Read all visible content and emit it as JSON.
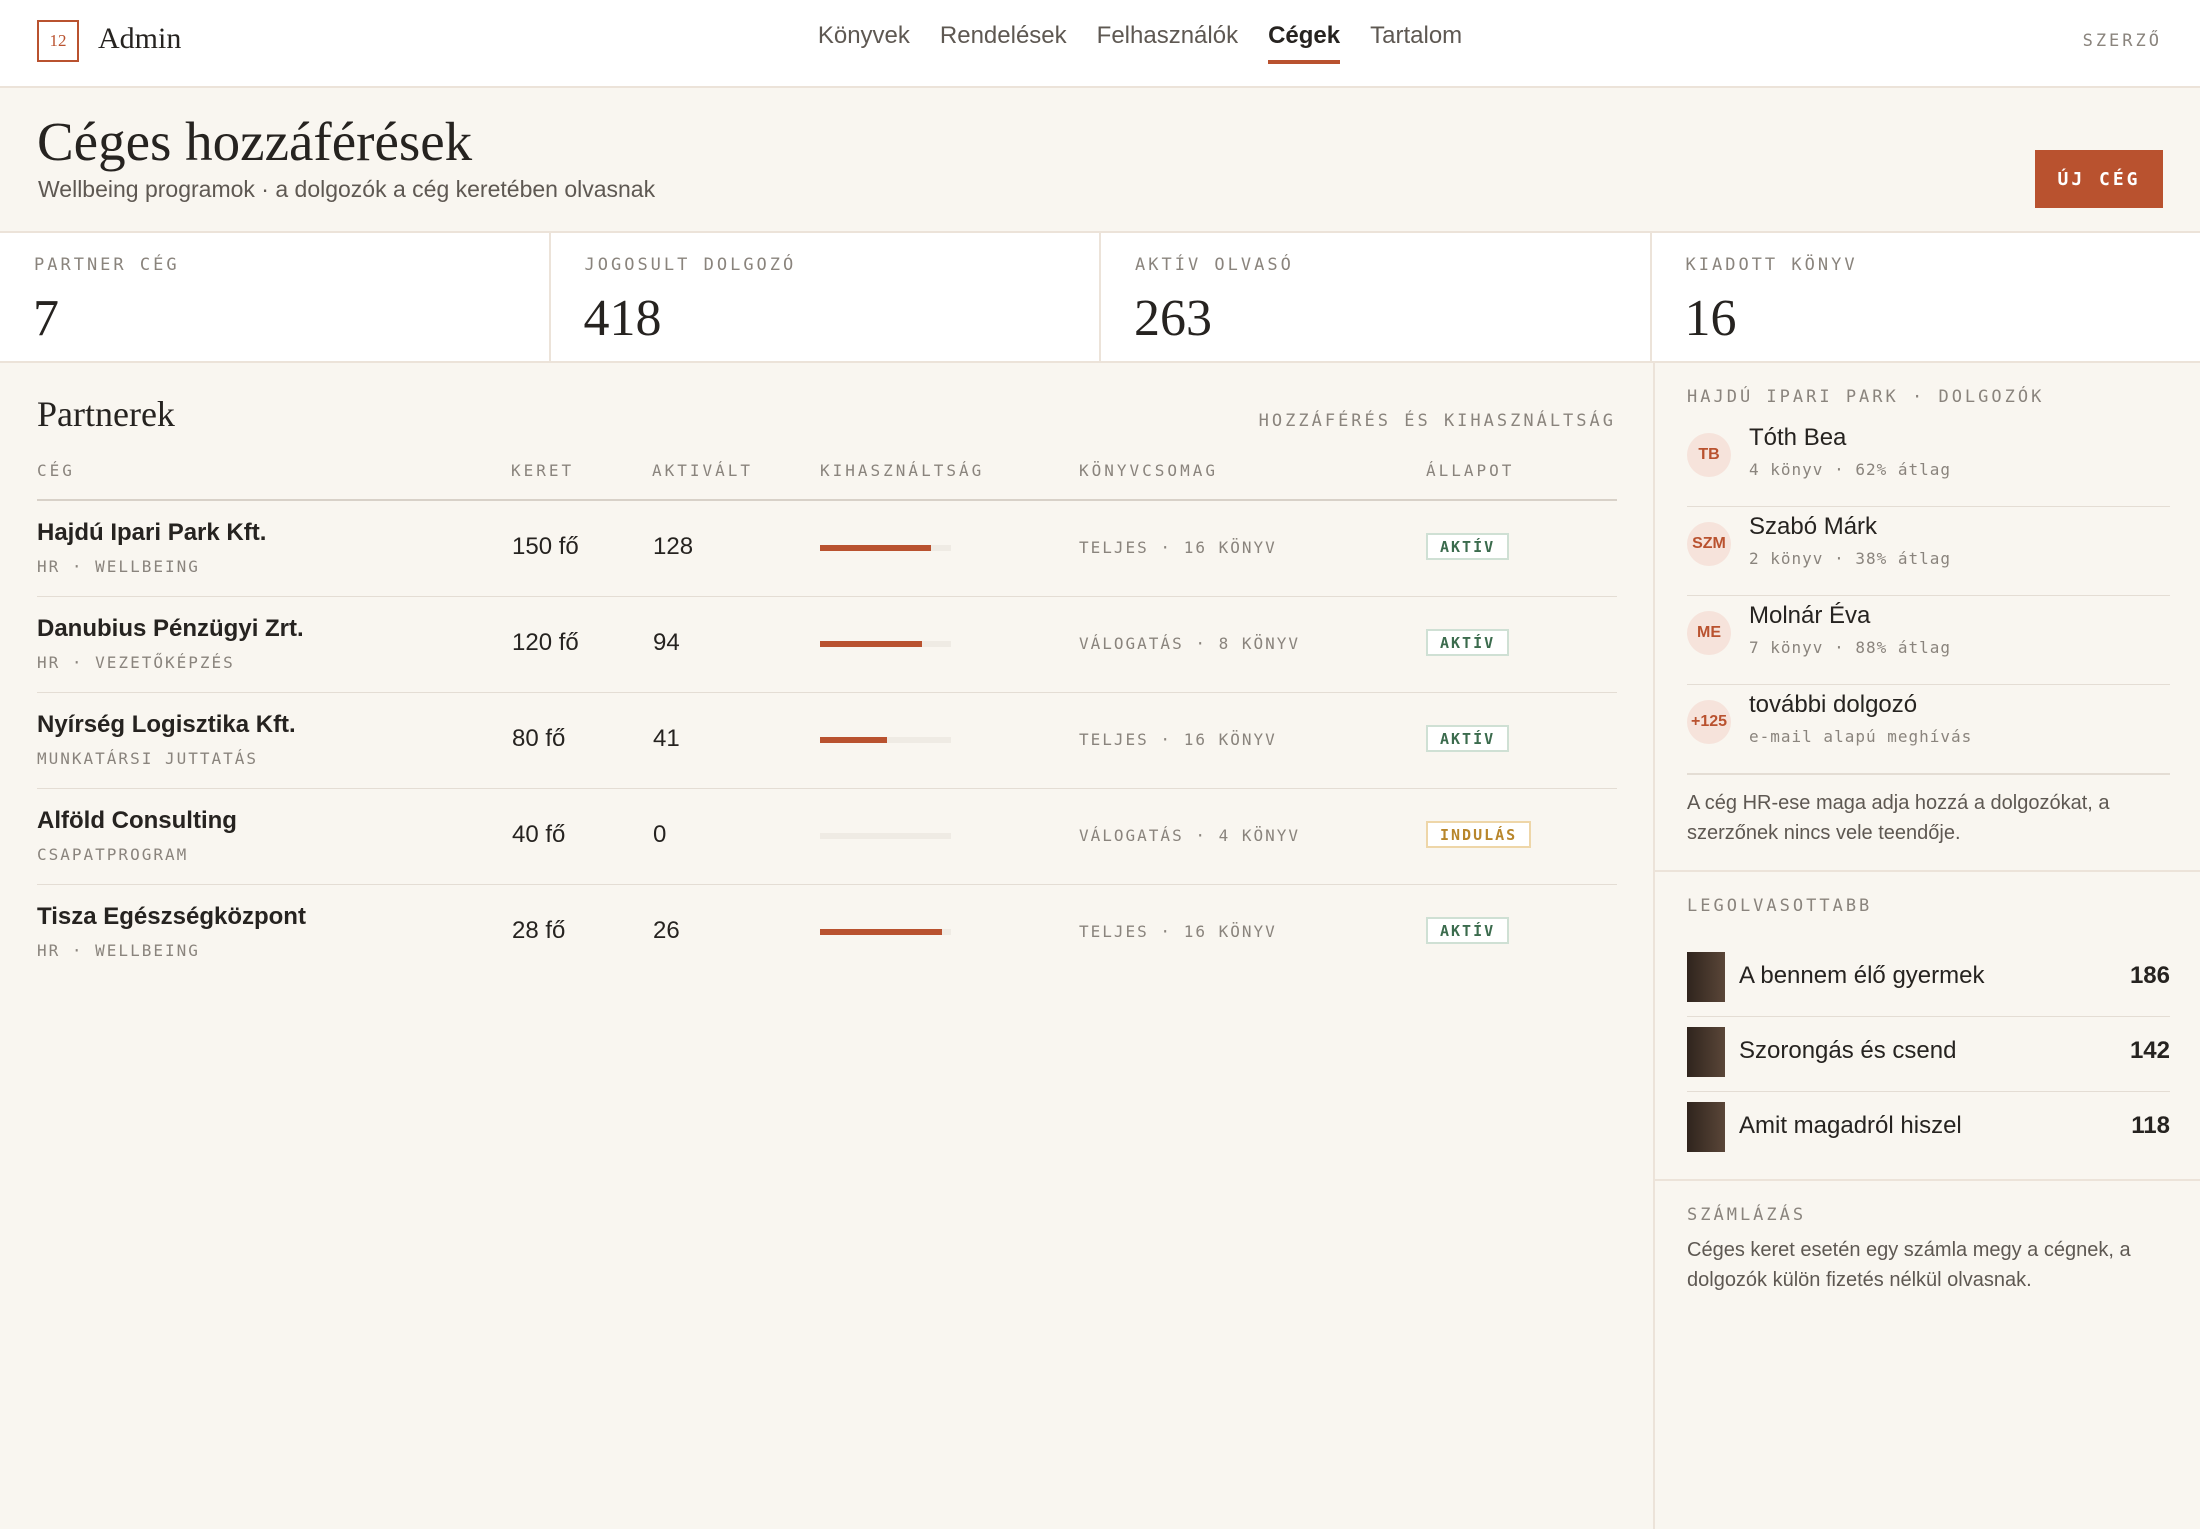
{
  "app": {
    "logo_text": "12",
    "brand": "Admin",
    "role": "SZERZŐ",
    "nav": [
      "Könyvek",
      "Rendelések",
      "Felhasználók",
      "Cégek",
      "Tartalom"
    ],
    "nav_active": "Cégek"
  },
  "header": {
    "title": "Céges hozzáférések",
    "subtitle": "Wellbeing programok · a dolgozók a cég keretében olvasnak",
    "new_button": "ÚJ CÉG"
  },
  "stats": [
    {
      "label": "PARTNER CÉG",
      "value": "7"
    },
    {
      "label": "JOGOSULT DOLGOZÓ",
      "value": "418"
    },
    {
      "label": "AKTÍV OLVASÓ",
      "value": "263"
    },
    {
      "label": "KIADOTT KÖNYV",
      "value": "16"
    }
  ],
  "partners": {
    "title": "Partnerek",
    "hint": "HOZZÁFÉRÉS ÉS KIHASZNÁLTSÁG",
    "columns": [
      "CÉG",
      "KERET",
      "AKTIVÁLT",
      "KIHASZNÁLTSÁG",
      "KÖNYVCSOMAG",
      "ÁLLAPOT"
    ],
    "rows": [
      {
        "name": "Hajdú Ipari Park Kft.",
        "sub": "HR · WELLBEING",
        "quota": "150 fő",
        "activated": "128",
        "usage": 0.85,
        "package": "TELJES · 16 KÖNYV",
        "status": "AKTÍV",
        "status_kind": "ok"
      },
      {
        "name": "Danubius Pénzügyi Zrt.",
        "sub": "HR · VEZETŐKÉPZÉS",
        "quota": "120 fő",
        "activated": "94",
        "usage": 0.78,
        "package": "VÁLOGATÁS · 8 KÖNYV",
        "status": "AKTÍV",
        "status_kind": "ok"
      },
      {
        "name": "Nyírség Logisztika Kft.",
        "sub": "MUNKATÁRSI JUTTATÁS",
        "quota": "80 fő",
        "activated": "41",
        "usage": 0.51,
        "package": "TELJES · 16 KÖNYV",
        "status": "AKTÍV",
        "status_kind": "ok"
      },
      {
        "name": "Alföld Consulting",
        "sub": "CSAPATPROGRAM",
        "quota": "40 fő",
        "activated": "0",
        "usage": 0.0,
        "package": "VÁLOGATÁS · 4 KÖNYV",
        "status": "INDULÁS",
        "status_kind": "warn"
      },
      {
        "name": "Tisza Egészségközpont",
        "sub": "HR · WELLBEING",
        "quota": "28 fő",
        "activated": "26",
        "usage": 0.93,
        "package": "TELJES · 16 KÖNYV",
        "status": "AKTÍV",
        "status_kind": "ok"
      }
    ]
  },
  "employees": {
    "label": "HAJDÚ IPARI PARK · DOLGOZÓK",
    "items": [
      {
        "initials": "TB",
        "name": "Tóth Bea",
        "meta": "4 könyv · 62% átlag"
      },
      {
        "initials": "SZM",
        "name": "Szabó Márk",
        "meta": "2 könyv · 38% átlag"
      },
      {
        "initials": "ME",
        "name": "Molnár Éva",
        "meta": "7 könyv · 88% átlag"
      },
      {
        "initials": "+125",
        "name": "további dolgozó",
        "meta": "e-mail alapú meghívás"
      }
    ],
    "note": "A cég HR-ese maga adja hozzá a dolgozókat, a szerzőnek nincs vele teendője."
  },
  "most_read": {
    "label": "LEGOLVASOTTABB",
    "items": [
      {
        "title": "A bennem élő gyermek",
        "count": "186"
      },
      {
        "title": "Szorongás és csend",
        "count": "142"
      },
      {
        "title": "Amit magadról hiszel",
        "count": "118"
      }
    ]
  },
  "billing": {
    "label": "SZÁMLÁZÁS",
    "text": "Céges keret esetén egy számla megy a cégnek, a dolgozók külön fizetés nélkül olvasnak."
  }
}
